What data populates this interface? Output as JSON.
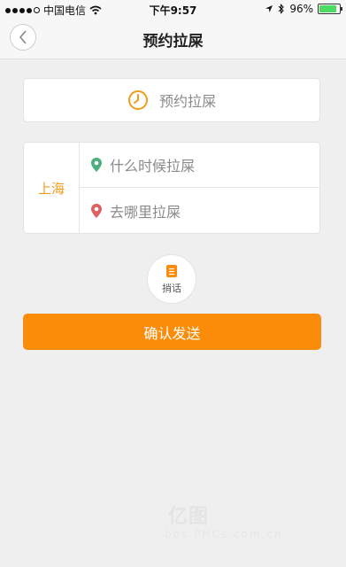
{
  "status_bar": {
    "carrier": "中国电信",
    "time": "下午9:57",
    "battery": "96%",
    "battery_level": 0.96,
    "icons": [
      "signal-icon",
      "wifi-icon",
      "location-arrow-icon",
      "bluetooth-icon",
      "battery-icon"
    ]
  },
  "nav": {
    "title": "预约拉屎",
    "back_icon": "chevron-left-icon"
  },
  "appointment": {
    "label": "预约拉屎",
    "icon": "clock-icon"
  },
  "location": {
    "city": "上海",
    "when_placeholder": "什么时候拉屎",
    "where_placeholder": "去哪里拉屎",
    "when_icon_color": "#4caf7d",
    "where_icon_color": "#e06060"
  },
  "message": {
    "label": "捎话",
    "icon": "note-icon"
  },
  "confirm": {
    "label": "确认发送"
  },
  "colors": {
    "accent": "#fa8c0a",
    "city": "#f39c1a"
  },
  "watermark": {
    "text": "亿图",
    "sub": "bbs.PHCs.com.cn"
  }
}
